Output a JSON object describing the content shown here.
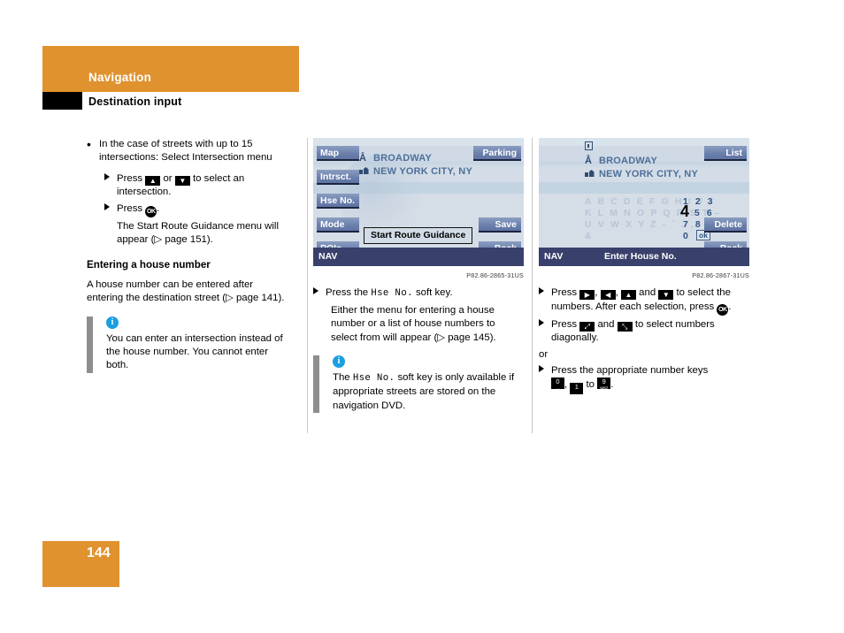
{
  "header": {
    "chapter": "Navigation",
    "section": "Destination input"
  },
  "footer": {
    "page_number": "144"
  },
  "accent_colors": {
    "orange": "#e0922f",
    "info_blue": "#1a9fe0",
    "nav_bar": "#39406b",
    "softkey_blue": "#7287b2",
    "dest_text": "#4e6f99",
    "disabled_char": "#b6c6d6"
  },
  "column_left": {
    "bullet_1": {
      "marker": "bullet-dot",
      "text": "In the case of streets with up to 15 intersections: Select Intersection menu"
    },
    "step_1": {
      "marker": "triangle-right",
      "pre": "Press",
      "key_up": "up-arrow-key",
      "mid": "or",
      "key_down": "down-arrow-key",
      "post": "to select an intersection."
    },
    "step_2": {
      "marker": "triangle-right",
      "pre": "Press",
      "key_ok": "OK",
      "post": "."
    },
    "step_2_note": "The Start Route Guidance menu will appear (▷ page 151).",
    "subheading": "Entering a house number",
    "paragraph": "A house number can be entered after entering the destination street (▷ page 141).",
    "note": {
      "icon": "info-icon",
      "icon_char": "i",
      "text": "You can enter an intersection instead of the house number. You cannot enter both."
    }
  },
  "column_middle": {
    "screenshot": {
      "caption": "P82.86-2865-31US",
      "softkeys_left": [
        {
          "label": "Map"
        },
        {
          "label": "Intrsct."
        },
        {
          "label": "Hse No."
        },
        {
          "label": "Mode"
        },
        {
          "label": "POIs"
        }
      ],
      "softkeys_right": [
        {
          "label": "Parking"
        },
        {
          "label": "Save"
        },
        {
          "label": "Back"
        }
      ],
      "destination": {
        "street_icon": "street-icon",
        "street_glyph": "Å",
        "street": "BROADWAY",
        "city_icon": "city-icon",
        "city": "NEW YORK CITY, NY"
      },
      "highlighted_button": "Start Route Guidance",
      "status_bar": {
        "left": "NAV",
        "center": ""
      }
    },
    "step_1": {
      "marker": "triangle-right",
      "pre": "Press the",
      "mono_key": "Hse No.",
      "post": "soft key."
    },
    "step_1_note": "Either the menu for entering a house number or a list of house numbers to select from will appear (▷ page 145).",
    "note": {
      "icon": "info-icon",
      "icon_char": "i",
      "pre": "The",
      "mono_key": "Hse No.",
      "post": "soft key is only available if appropriate streets are stored on the navigation DVD."
    }
  },
  "column_right": {
    "screenshot": {
      "caption": "P82.86-2867-31US",
      "softkeys_right": [
        {
          "label": "List"
        },
        {
          "label": "Delete"
        },
        {
          "label": "Back"
        }
      ],
      "destination": {
        "house_no_icon": "house-number-icon",
        "street_icon": "street-icon",
        "street_glyph": "Å",
        "street": "BROADWAY",
        "city_icon": "city-icon",
        "city": "NEW YORK CITY, NY"
      },
      "keyboard": {
        "letter_rows": [
          "A B C D E F G H I J",
          "K L M N O P Q R S T –",
          "U V W X Y Z - ` . ,",
          "&"
        ],
        "number_rows": [
          "1 2 3",
          "4 5 6",
          "7 8 9",
          "0"
        ],
        "selected_char": "4",
        "ok_chip": "ok",
        "letters_disabled": true
      },
      "status_bar": {
        "left": "NAV",
        "center": "Enter House No."
      }
    },
    "step_1": {
      "marker": "triangle-right",
      "pre": "Press",
      "key_right": "right-arrow-key",
      "key_left": "left-arrow-key",
      "key_up": "up-arrow-key",
      "mid": "and",
      "key_down": "down-arrow-key",
      "post": "to select the numbers. After each selection, press",
      "key_ok": "OK",
      "end": "."
    },
    "step_2": {
      "marker": "triangle-right",
      "pre": "Press",
      "key_diag_down": "diagonal-down-arrow-key",
      "mid": "and",
      "key_diag_up": "diagonal-up-arrow-key",
      "post": "to select numbers diagonally."
    },
    "or_text": "or",
    "step_3": {
      "marker": "triangle-right",
      "text": "Press the appropriate number keys",
      "key_0": "0",
      "key_0_sub": "␣",
      "key_1": "1",
      "mid": "to",
      "key_9": "9",
      "key_9_sub": "wxyz",
      "end": "."
    }
  }
}
